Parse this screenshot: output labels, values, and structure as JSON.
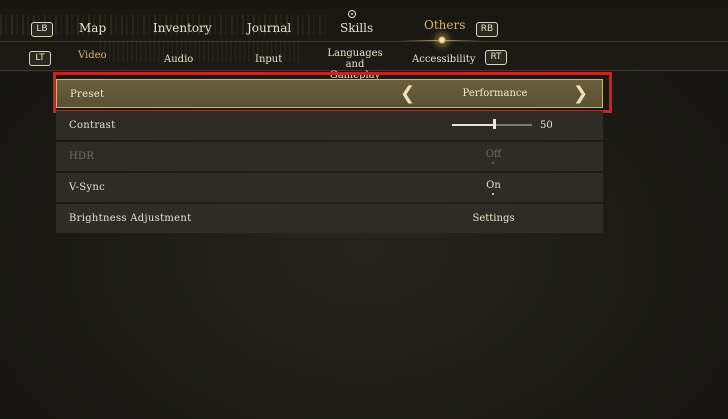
{
  "top_nav": {
    "lb": "LB",
    "rb": "RB",
    "tabs": [
      {
        "label": "Map"
      },
      {
        "label": "Inventory"
      },
      {
        "label": "Journal"
      },
      {
        "label": "Skills"
      },
      {
        "label": "Others"
      }
    ],
    "active_tab": "Others"
  },
  "sub_nav": {
    "lt": "LT",
    "rt": "RT",
    "tabs": [
      {
        "label": "Video"
      },
      {
        "label": "Audio"
      },
      {
        "label": "Input"
      },
      {
        "label": "Languages and Gameplay"
      },
      {
        "label": "Accessibility"
      }
    ],
    "active_tab": "Video"
  },
  "settings": [
    {
      "label": "Preset",
      "value": "Performance",
      "selected": true
    },
    {
      "label": "Contrast",
      "value": "50",
      "slider_fraction": 0.52
    },
    {
      "label": "HDR",
      "value": "Off",
      "disabled": true
    },
    {
      "label": "V-Sync",
      "value": "On"
    },
    {
      "label": "Brightness Adjustment",
      "value": "Settings"
    }
  ],
  "colors": {
    "accent_gold": "#d8b25a",
    "highlight_red": "#e0181e",
    "row_bg": "#2d2c26",
    "selected_row_bg": "#62573a"
  }
}
